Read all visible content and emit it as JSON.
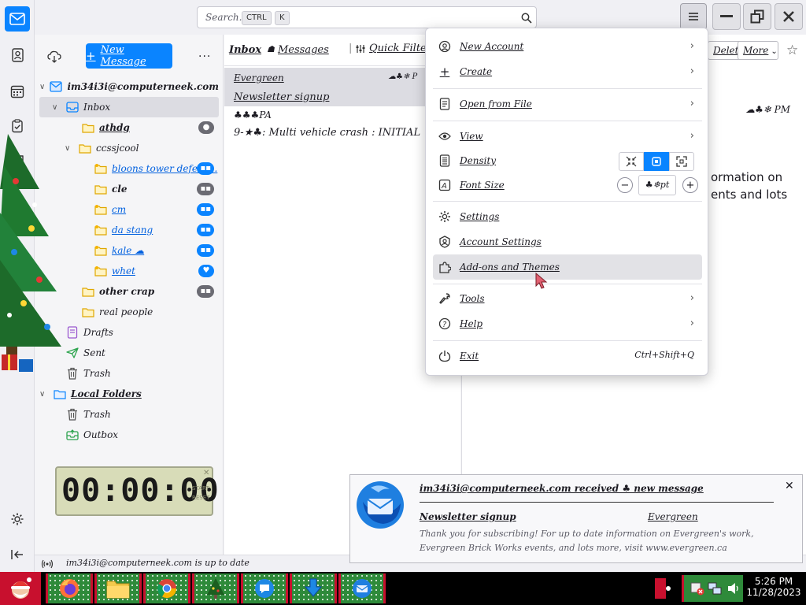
{
  "search": {
    "placeholder": "Search...",
    "kbd1": "CTRL",
    "kbd2": "K"
  },
  "folder_pane": {
    "new_message_label": "New Message",
    "account": "im34i3i@computerneek.com",
    "folders": [
      {
        "name": "Inbox"
      },
      {
        "name": "athdg",
        "badge": "●"
      },
      {
        "name": "ccssjcool"
      },
      {
        "name": "bloons tower defens...",
        "badge": "▪▪"
      },
      {
        "name": "cle",
        "badge": "▪▪"
      },
      {
        "name": "cm",
        "badge": "▪▪"
      },
      {
        "name": "da stang",
        "badge": "▪▪"
      },
      {
        "name": "kale ☁",
        "badge": "▪▪"
      },
      {
        "name": "whet",
        "badge": "♥"
      },
      {
        "name": "other crap",
        "badge": "▪▪"
      },
      {
        "name": "real people"
      },
      {
        "name": "Drafts"
      },
      {
        "name": "Sent"
      },
      {
        "name": "Trash"
      },
      {
        "name": "Local Folders"
      },
      {
        "name": "Trash"
      },
      {
        "name": "Outbox"
      }
    ]
  },
  "clock": {
    "digits": "00:00:00",
    "start": "START",
    "reset": "RESET"
  },
  "statusbar": {
    "text": "im34i3i@computerneek.com is up to date"
  },
  "message_list": {
    "folder": "Inbox",
    "messages_label": "Messages",
    "quick_filter": "Quick Filter",
    "rows": [
      {
        "text": "Evergreen",
        "meta": "☁♣❄ P"
      },
      {
        "text": "Newsletter signup",
        "meta": ""
      },
      {
        "text": "♣♣♣PA",
        "meta": ""
      },
      {
        "text": "9-★♣: Multi vehicle crash : INITIAL",
        "meta": ""
      }
    ]
  },
  "reader": {
    "delete_label": "Delete",
    "more_label": "More",
    "time": "☁♣❄ PM",
    "body_line1": "ormation on",
    "body_line2": "ents and lots"
  },
  "app_menu": {
    "items": [
      {
        "label": "New Account",
        "icon": "new-account-icon",
        "chevron": true
      },
      {
        "label": "Create",
        "icon": "plus-icon",
        "chevron": true
      },
      {
        "label": "Open from File",
        "icon": "file-icon",
        "chevron": true
      },
      {
        "label": "View",
        "icon": "eye-icon",
        "chevron": true
      },
      {
        "label": "Density",
        "icon": "density-icon",
        "chevron": false
      },
      {
        "label": "Font Size",
        "icon": "font-size-icon",
        "chevron": false
      },
      {
        "label": "Settings",
        "icon": "gear-icon",
        "chevron": false
      },
      {
        "label": "Account Settings",
        "icon": "account-settings-icon",
        "chevron": false
      },
      {
        "label": "Add-ons and Themes",
        "icon": "puzzle-icon",
        "chevron": false
      },
      {
        "label": "Tools",
        "icon": "wrench-icon",
        "chevron": true
      },
      {
        "label": "Help",
        "icon": "help-icon",
        "chevron": true
      },
      {
        "label": "Exit",
        "icon": "power-icon",
        "chevron": false
      }
    ],
    "font_size_value": "♣❄pt",
    "exit_shortcut": "Ctrl+Shift+Q"
  },
  "notification": {
    "title": "im34i3i@computerneek.com received ♣ new message",
    "subject": "Newsletter signup",
    "sender": "Evergreen",
    "body": "Thank you for subscribing! For up to date information on Evergreen's work, Evergreen Brick Works events, and lots more, visit www.evergreen.ca"
  },
  "taskbar": {
    "time": "5:26 PM",
    "date": "11/28/2023"
  },
  "colors": {
    "accent": "#0a84ff",
    "taskbar_green": "#2e8a3a",
    "taskbar_red": "#c8102e"
  }
}
